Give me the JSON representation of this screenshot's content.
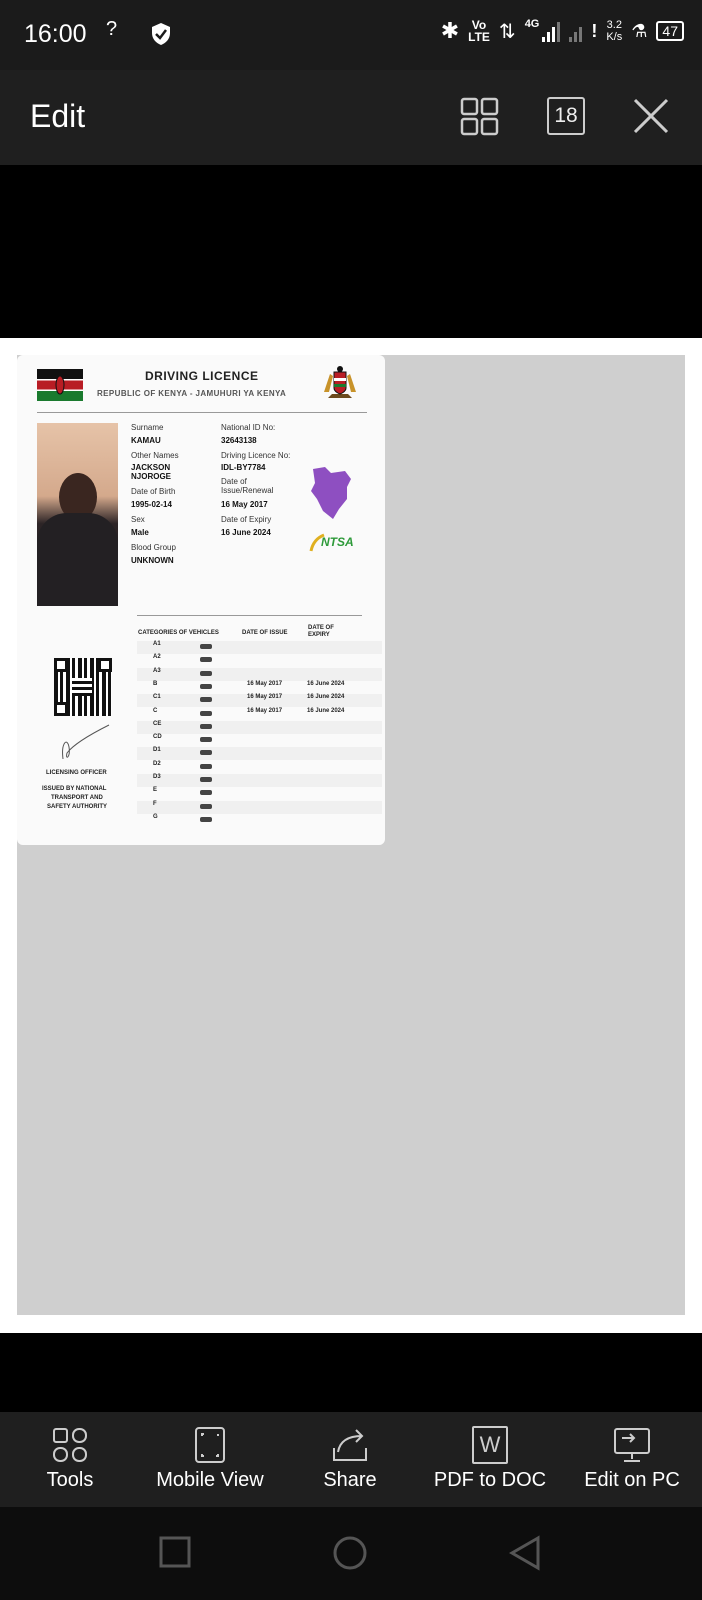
{
  "status_bar": {
    "time": "16:00",
    "network_unknown": "?",
    "volte": "Vo\nLTE",
    "network_type": "4G",
    "speed_value": "3.2",
    "speed_unit": "K/s",
    "battery": "47"
  },
  "top_bar": {
    "title": "Edit",
    "page_count": "18"
  },
  "licence": {
    "title": "DRIVING LICENCE",
    "subtitle": "REPUBLIC OF KENYA - JAMUHURI YA KENYA",
    "surname_label": "Surname",
    "surname": "KAMAU",
    "other_names_label": "Other Names",
    "other_names_1": "JACKSON",
    "other_names_2": "NJOROGE",
    "dob_label": "Date of Birth",
    "dob": "1995-02-14",
    "sex_label": "Sex",
    "sex": "Male",
    "blood_label": "Blood Group",
    "blood": "UNKNOWN",
    "national_id_label": "National ID No:",
    "national_id": "32643138",
    "licence_no_label": "Driving Licence No:",
    "licence_no": "IDL-BY7784",
    "issue_label_1": "Date of",
    "issue_label_2": "Issue/Renewal",
    "issue_date": "16 May 2017",
    "expiry_label": "Date of Expiry",
    "expiry_date": "16 June 2024",
    "ntsa": "NTSA",
    "officer": "LICENSING OFFICER",
    "issued_by_1": "ISSUED BY NATIONAL",
    "issued_by_2": "TRANSPORT AND",
    "issued_by_3": "SAFETY AUTHORITY",
    "col_categories": "CATEGORIES OF VEHICLES",
    "col_issue": "DATE OF ISSUE",
    "col_expiry_1": "DATE OF",
    "col_expiry_2": "EXPIRY",
    "categories": [
      {
        "code": "A1",
        "issue": "",
        "expiry": ""
      },
      {
        "code": "A2",
        "issue": "",
        "expiry": ""
      },
      {
        "code": "A3",
        "issue": "",
        "expiry": ""
      },
      {
        "code": "B",
        "issue": "16 May 2017",
        "expiry": "16 June 2024"
      },
      {
        "code": "C1",
        "issue": "16 May 2017",
        "expiry": "16 June 2024"
      },
      {
        "code": "C",
        "issue": "16 May 2017",
        "expiry": "16 June 2024"
      },
      {
        "code": "CE",
        "issue": "",
        "expiry": ""
      },
      {
        "code": "CD",
        "issue": "",
        "expiry": ""
      },
      {
        "code": "D1",
        "issue": "",
        "expiry": ""
      },
      {
        "code": "D2",
        "issue": "",
        "expiry": ""
      },
      {
        "code": "D3",
        "issue": "",
        "expiry": ""
      },
      {
        "code": "E",
        "issue": "",
        "expiry": ""
      },
      {
        "code": "F",
        "issue": "",
        "expiry": ""
      },
      {
        "code": "G",
        "issue": "",
        "expiry": ""
      }
    ]
  },
  "bottom_tools": {
    "tools": "Tools",
    "mobile_view": "Mobile View",
    "share": "Share",
    "pdf_to_doc": "PDF to DOC",
    "edit_on_pc": "Edit on PC",
    "word_letter": "W"
  },
  "colors": {
    "bar_bg": "#1f1f1f",
    "page_grey": "#cfcfcf",
    "kenya_purple": "#8e4fc1",
    "ntsa_green": "#2e9a3a"
  }
}
